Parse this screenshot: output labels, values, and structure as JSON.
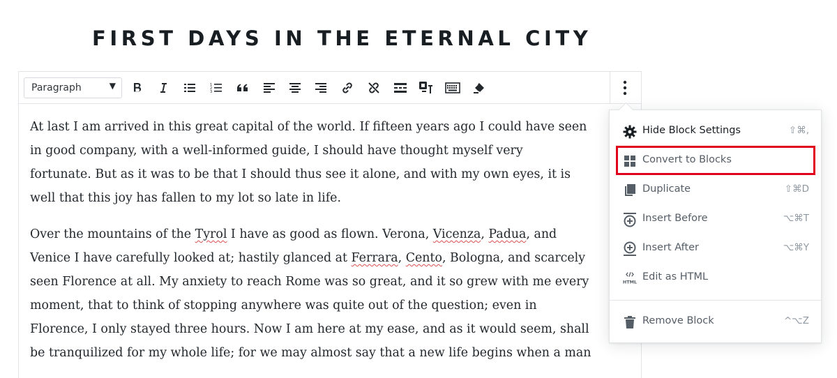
{
  "post": {
    "title": "FIRST DAYS IN THE ETERNAL CITY"
  },
  "toolbar": {
    "format_select": {
      "value": "Paragraph",
      "caret": "▼"
    },
    "buttons": [
      {
        "name": "bold-button",
        "icon": "bold-icon"
      },
      {
        "name": "italic-button",
        "icon": "italic-icon"
      },
      {
        "name": "bulleted-list-button",
        "icon": "bulleted-list-icon"
      },
      {
        "name": "numbered-list-button",
        "icon": "numbered-list-icon"
      },
      {
        "name": "blockquote-button",
        "icon": "quote-icon"
      },
      {
        "name": "align-left-button",
        "icon": "align-left-icon"
      },
      {
        "name": "align-center-button",
        "icon": "align-center-icon"
      },
      {
        "name": "align-right-button",
        "icon": "align-right-icon"
      },
      {
        "name": "insert-link-button",
        "icon": "link-icon"
      },
      {
        "name": "remove-link-button",
        "icon": "unlink-icon"
      },
      {
        "name": "read-more-button",
        "icon": "read-more-icon"
      },
      {
        "name": "text-color-button",
        "icon": "text-color-icon"
      },
      {
        "name": "keyboard-shortcuts-button",
        "icon": "keyboard-icon"
      },
      {
        "name": "clear-formatting-button",
        "icon": "eraser-icon"
      }
    ],
    "more_icon": "vertical-ellipsis-icon"
  },
  "content": {
    "p1": [
      "At last I am arrived in this great capital of the world. If fifteen years ago I could have seen",
      "in good company, with a well-informed guide, I should have thought myself very",
      "fortunate. But as it was to be that I should thus see it alone, and with my own eyes, it is",
      "well that this joy has fallen to my lot so late in life."
    ],
    "p2": {
      "l1a": "Over the mountains of the ",
      "tyrol": "Tyrol",
      "l1b": " I have as good as flown. Verona, ",
      "vicenza": "Vicenza",
      "l1c": ", ",
      "padua": "Padua",
      "l1d": ", and",
      "l2a": "Venice I have carefully looked at; hastily glanced at ",
      "ferrara": "Ferrara",
      "l2b": ", ",
      "cento": "Cento",
      "l2c": ", Bologna, and scarcely",
      "l3": "seen Florence at all. My anxiety to reach Rome was so great, and it so grew with me every",
      "l4": "moment, that to think of stopping anywhere was quite out of the question; even in",
      "l5": "Florence, I only stayed three hours. Now I am here at my ease, and as it would seem, shall",
      "l6": "be tranquilized for my whole life; for we may almost say that a new life begins when a man"
    }
  },
  "menu": {
    "items": [
      {
        "label": "Hide Block Settings",
        "shortcut": "⇧⌘,",
        "icon": "gear-icon"
      },
      {
        "label": "Convert to Blocks",
        "shortcut": "",
        "icon": "blocks-grid-icon"
      },
      {
        "label": "Duplicate",
        "shortcut": "⇧⌘D",
        "icon": "duplicate-icon"
      },
      {
        "label": "Insert Before",
        "shortcut": "⌥⌘T",
        "icon": "insert-before-icon"
      },
      {
        "label": "Insert After",
        "shortcut": "⌥⌘Y",
        "icon": "insert-after-icon"
      },
      {
        "label": "Edit as HTML",
        "shortcut": "",
        "icon": "html-icon",
        "icon_text": "HTML"
      },
      {
        "label": "Remove Block",
        "shortcut": "^⌥Z",
        "icon": "trash-icon"
      }
    ],
    "highlight_color": "#e0001b"
  },
  "colors": {
    "text": "#23282d",
    "menu_text": "#555d66",
    "shortcut_text": "#8f98a1",
    "border": "#e2e4e7",
    "spellcheck": "#d94f4f"
  }
}
